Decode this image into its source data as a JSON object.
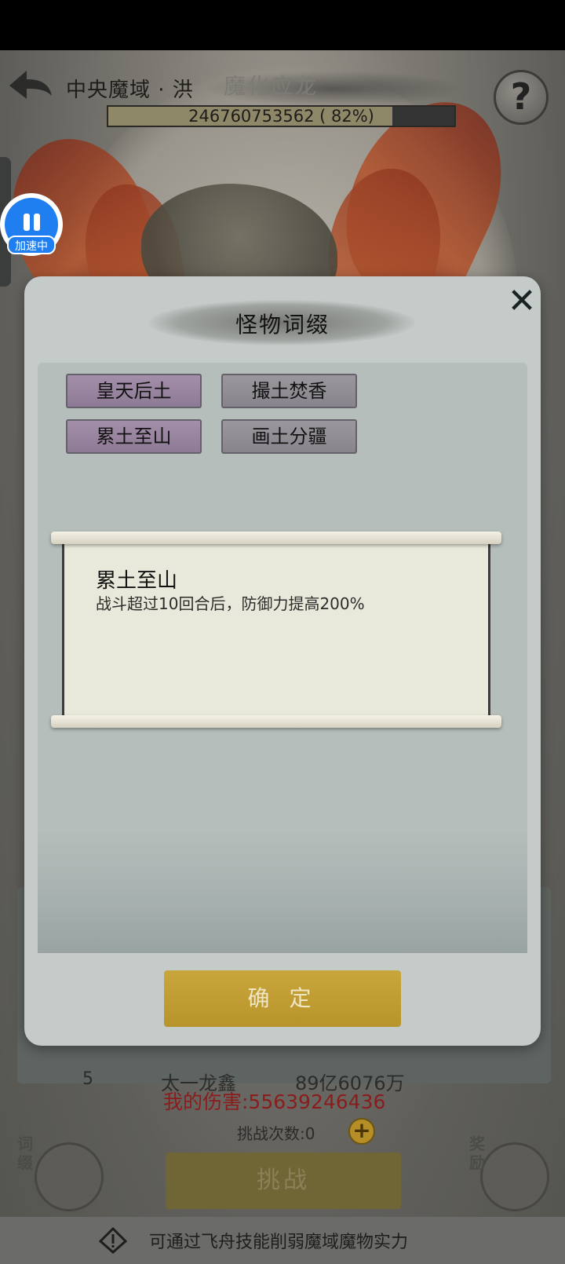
{
  "header": {
    "region_title": "中央魔域 · 洪",
    "boss_name": "魔化应龙",
    "hp_text": "246760753562 ( 82%)",
    "hp_fraction": 0.82
  },
  "speed_button": {
    "label": "加速中"
  },
  "modal": {
    "title": "怪物词缀",
    "affixes": [
      {
        "label": "皇天后土",
        "style": "purple"
      },
      {
        "label": "撮土焚香",
        "style": "gray"
      },
      {
        "label": "累土至山",
        "style": "purple"
      },
      {
        "label": "画土分疆",
        "style": "gray"
      }
    ],
    "detail": {
      "name": "累土至山",
      "description": "战斗超过10回合后，防御力提高200%"
    },
    "confirm_label": "确 定"
  },
  "ranking_row": {
    "rank": "5",
    "name": "太一龙鑫",
    "value": "89亿6076万"
  },
  "my_damage": "我的伤害:55639246436",
  "challenge_count": "挑战次数:0",
  "challenge_label": "挑战",
  "side_tabs": {
    "affix": "词缀",
    "reward": "奖励"
  },
  "bottom_tip": "可通过飞舟技能削弱魔域魔物实力",
  "colors": {
    "confirm": "#c9a63b",
    "speed_blue": "#1f7ff0",
    "damage_red": "#8a1c1c"
  }
}
